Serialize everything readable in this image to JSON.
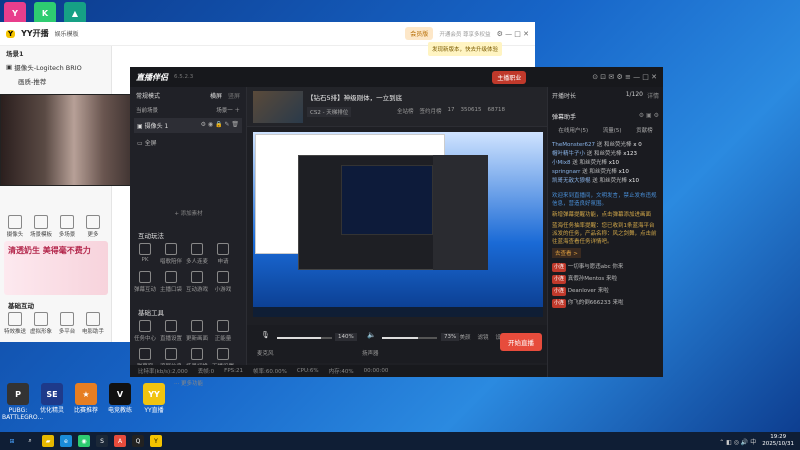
{
  "desktop_icons_top": [
    {
      "name": "yy-icon",
      "label": "",
      "color": "#e83e8c",
      "glyph": "Y"
    },
    {
      "name": "kook-icon",
      "label": "",
      "color": "#2ecc71",
      "glyph": "K"
    },
    {
      "name": "app-icon",
      "label": "",
      "color": "#16a085",
      "glyph": "▲"
    }
  ],
  "desktop_icons_bottom": [
    {
      "label": "PUBG: BATTLEGRO...",
      "color": "#333",
      "glyph": "P"
    },
    {
      "label": "优化精灵",
      "color": "#1e3a8a",
      "glyph": "SE"
    },
    {
      "label": "比赛推荐",
      "color": "#e67e22",
      "glyph": "★"
    },
    {
      "label": "电竞教练",
      "color": "#111",
      "glyph": "V"
    },
    {
      "label": "YY直播",
      "color": "#f1c40f",
      "glyph": "YY"
    }
  ],
  "yy": {
    "app_name": "YY开播",
    "tab": "娱乐模板",
    "badge": "会员版",
    "promo": "开通会员 尊享多权益",
    "tooltip": "发现新版本，快去升级体验",
    "scene_title": "场景1",
    "camera_item": "摄像头-Logitech BRIO",
    "sub_item": "画质-推荐",
    "tools": [
      "摄像头",
      "场景模板",
      "多场景",
      "更多"
    ],
    "promo_banner": "清透奶生 美得毫不费力",
    "interact_title": "基础互动",
    "interact": [
      "特效推送",
      "虚拟形象",
      "多平台",
      "电影助手"
    ]
  },
  "live": {
    "app_name": "直播伴侣",
    "version": "6.5.2.3",
    "upgrade": "主播职业",
    "mode_title": "常规模式",
    "mode_actions": [
      "横屏",
      "竖屏"
    ],
    "scene_header": "当前场景",
    "scene_switch": "场景一",
    "sources": [
      "摄像头 1",
      "全屏"
    ],
    "add_source": "+ 添加素材",
    "stream_title": "【钻石5排】神级刚体，一立到底",
    "game_tag": "CS2 - 天梯排位",
    "counters": [
      "全站榜",
      "签约月榜",
      "17",
      "350615",
      "68718"
    ],
    "activity_title": "互动玩法",
    "activity": [
      "PK",
      "唱歌陪伴",
      "多人连麦",
      "申请",
      "弹幕互动",
      "主播口袋",
      "互动游戏",
      "小游戏"
    ],
    "tools_title": "基础工具",
    "tools": [
      "任务中心",
      "直播设置",
      "更新画面",
      "正能量",
      "弹幕窗",
      "滚屏信息",
      "场景切换",
      "下播设置"
    ],
    "more": "更多功能",
    "mic_label": "麦克风",
    "mic_value": "140%",
    "speaker_label": "扬声器",
    "speaker_value": "73%",
    "ctrl_buttons": [
      "美颜",
      "滤镜",
      "设置"
    ],
    "start_live": "开始直播",
    "status": [
      "比特率(kb/s):2,000",
      "丢帧:0",
      "FPS:21",
      "帧率:60.00%",
      "CPU:6%",
      "内存:40%",
      "00:00:00"
    ],
    "right_header": "开播时长",
    "right_count": "1/120",
    "right_detail": "详情",
    "assistant": "弹幕助手",
    "right_tabs": [
      "在线用户(5)",
      "流量(5)",
      "贡献榜"
    ],
    "gifts": [
      {
        "user": "TheMonster627",
        "text": "送 和丝荧光棒",
        "count": "x 0"
      },
      {
        "user": "帽叶精牛子小",
        "text": "送 和丝荧光棒",
        "count": "x123"
      },
      {
        "user": "小Mix8",
        "text": "送 和丝荧光棒",
        "count": "x10"
      },
      {
        "user": "springnarr",
        "text": "送 和丝荧光棒",
        "count": "x10"
      },
      {
        "user": "凯哥无敌大狼棍",
        "text": "送 和丝荧光棒",
        "count": "x10"
      }
    ],
    "chat_notice": "欢迎来到直播间，文明发言，禁止发布违规信息，营造良好氛围。",
    "chat_tip": "新增弹幕提醒功能，点击弹幕添加进画面",
    "chat_tip2": "蓝海任务抽率提醒：您已收到1条蓝海平台派发的任务，产品名称：风之剑舞，点击前往蓝海查看任务详情吧。",
    "go_check": "去查看 >",
    "messages": [
      {
        "tag": "小连",
        "text": "一切事与愿违abc 你来"
      },
      {
        "tag": "小连",
        "text": "真假孙Mentos 来啦"
      },
      {
        "tag": "小连",
        "text": "Deanlover 来啦"
      },
      {
        "tag": "小连",
        "text": "你飞的倒666233 来啦"
      }
    ]
  },
  "taskbar": {
    "time": "19:29",
    "date": "2025/10/31"
  }
}
